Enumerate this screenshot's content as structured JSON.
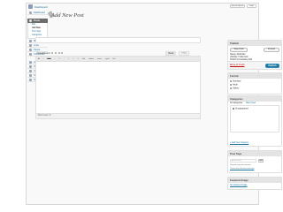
{
  "admin_bar": {
    "site_name": "Dashboard",
    "screen_options": "Screen Options",
    "help": "Help"
  },
  "sidebar": {
    "dashboard": "Dashboard",
    "posts": "Posts",
    "post_subitems": [
      "Edit",
      "Add New",
      "Post Tags",
      "Categories"
    ],
    "media": "Media",
    "links": "Links",
    "pages": "Pages",
    "comments": "Comments",
    "appearance": "Appearance",
    "plugins": "Plugins",
    "users": "Users",
    "tools": "Tools",
    "settings": "Settings"
  },
  "page": {
    "title": "Add New Post"
  },
  "editor": {
    "upload_insert": "Upload/Insert",
    "tab_visual": "Visual",
    "tab_html": "HTML",
    "toolbar": [
      "B",
      "I",
      "ABC",
      "•",
      "1.",
      "“",
      "≡",
      "≡",
      "≡",
      "link",
      "unlink",
      "more",
      "spell",
      "full"
    ],
    "word_count": "Word count: 0"
  },
  "publish_box": {
    "title": "Publish",
    "save_draft": "Save Draft",
    "preview": "Preview",
    "status": "Status: Draft Edit",
    "visibility": "Visibility: Public Edit",
    "schedule": "Publish immediately Edit",
    "move_to_trash": "Move to Trash",
    "publish": "Publish"
  },
  "format_box": {
    "title": "Format",
    "options": [
      "Standard",
      "Aside",
      "Gallery"
    ],
    "selected": "Standard"
  },
  "categories_box": {
    "title": "Categories",
    "tab_all": "All Categories",
    "tab_popular": "Most Used",
    "items": [
      "Uncategorized"
    ],
    "add_new": "+ Add New Category"
  },
  "tags_box": {
    "title": "Post Tags",
    "input_placeholder": "Add new tag",
    "add_button": "Add",
    "note": "Separate tags with commas",
    "choose_link": "Choose from the most used tags"
  },
  "featured_box": {
    "title": "Featured Image",
    "link": "Set featured image"
  },
  "colors": {
    "accent": "#21759b",
    "menu_active": "#6d6d6d",
    "trash": "#bc0b0b"
  }
}
